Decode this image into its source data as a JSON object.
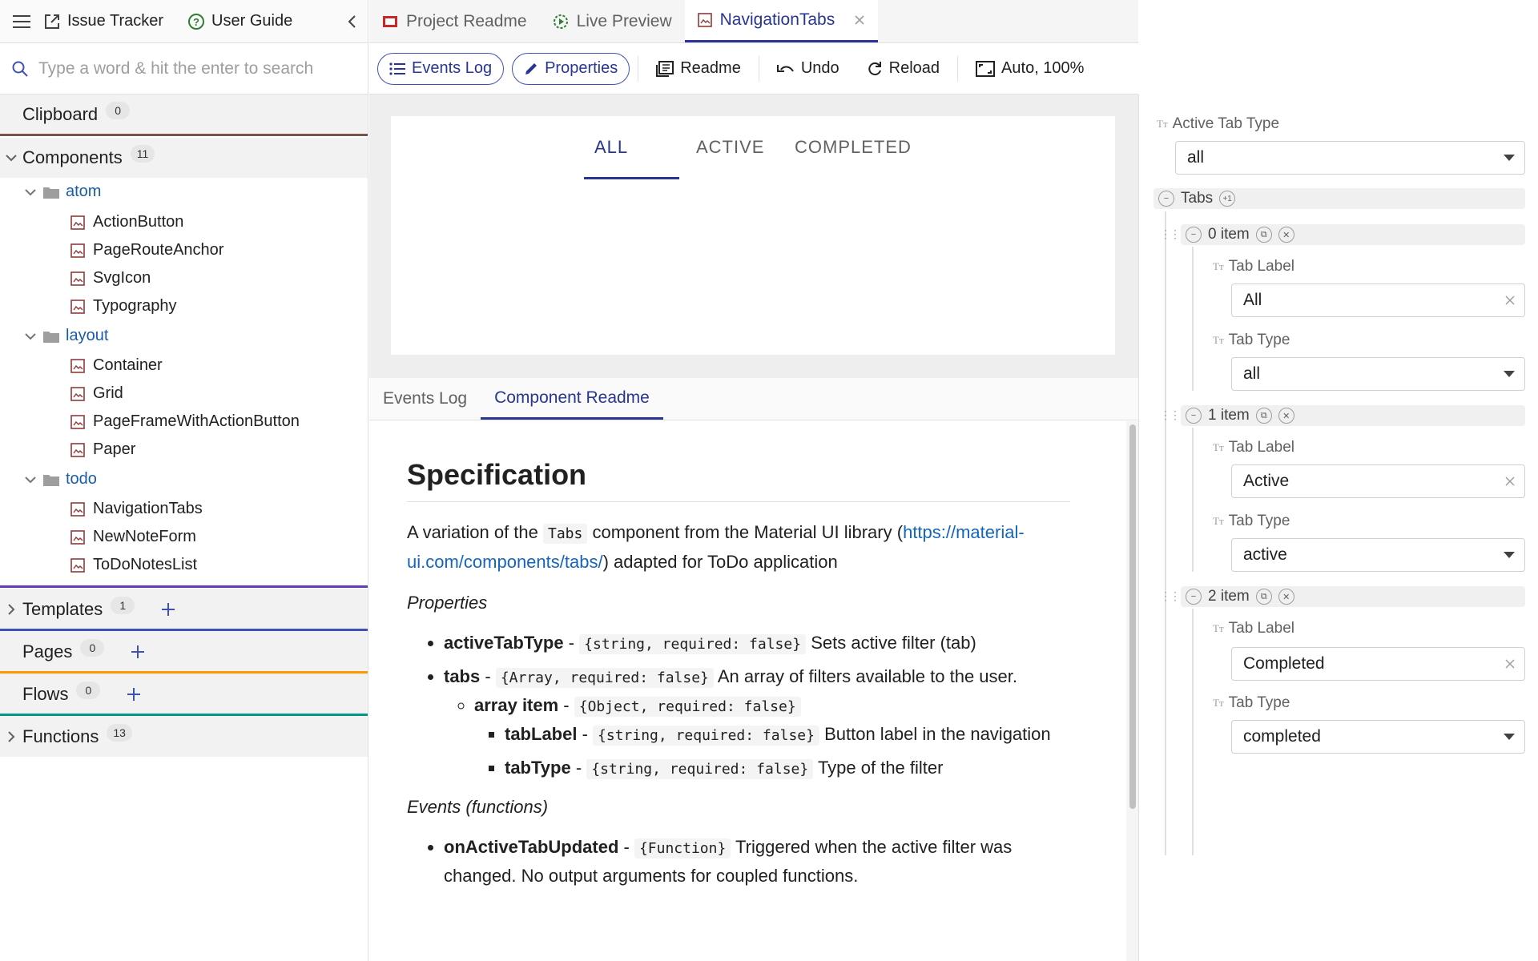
{
  "topbar": {
    "issue_tracker": "Issue Tracker",
    "user_guide": "User Guide"
  },
  "search": {
    "placeholder": "Type a word & hit the enter to search"
  },
  "sections": {
    "clipboard": {
      "label": "Clipboard",
      "count": "0"
    },
    "components": {
      "label": "Components",
      "count": "11"
    },
    "templates": {
      "label": "Templates",
      "count": "1"
    },
    "pages": {
      "label": "Pages",
      "count": "0"
    },
    "flows": {
      "label": "Flows",
      "count": "0"
    },
    "functions": {
      "label": "Functions",
      "count": "13"
    }
  },
  "tree": {
    "atom": {
      "label": "atom",
      "items": [
        "ActionButton",
        "PageRouteAnchor",
        "SvgIcon",
        "Typography"
      ]
    },
    "layout": {
      "label": "layout",
      "items": [
        "Container",
        "Grid",
        "PageFrameWithActionButton",
        "Paper"
      ]
    },
    "todo": {
      "label": "todo",
      "items": [
        "NavigationTabs",
        "NewNoteForm",
        "ToDoNotesList"
      ]
    }
  },
  "file_tabs": [
    "Project Readme",
    "Live Preview",
    "NavigationTabs"
  ],
  "toolbar": {
    "events_log": "Events Log",
    "properties": "Properties",
    "readme": "Readme",
    "undo": "Undo",
    "reload": "Reload",
    "zoom": "Auto, 100%"
  },
  "preview": {
    "tabs": [
      "ALL",
      "ACTIVE",
      "COMPLETED"
    ]
  },
  "sub_tabs": [
    "Events Log",
    "Component Readme"
  ],
  "readme": {
    "title": "Specification",
    "intro_1": "A variation of the ",
    "intro_code": "Tabs",
    "intro_2": " component from the Material UI library (",
    "intro_link": "https://material-ui.com/components/tabs/",
    "intro_3": ") adapted for ToDo application",
    "properties_heading": "Properties",
    "p1_name": "activeTabType",
    "p1_type": "{string, required: false}",
    "p1_desc": "Sets active filter (tab)",
    "p2_name": "tabs",
    "p2_type": "{Array, required: false}",
    "p2_desc": "An array of filters available to the user.",
    "p3_name": "array item",
    "p3_type": "{Object, required: false}",
    "p4_name": "tabLabel",
    "p4_type": "{string, required: false}",
    "p4_desc": "Button label in the navigation",
    "p5_name": "tabType",
    "p5_type": "{string, required: false}",
    "p5_desc": "Type of the filter",
    "events_heading": "Events (functions)",
    "e1_name": "onActiveTabUpdated",
    "e1_type": "{Function}",
    "e1_desc": "Triggered when the active filter was changed. No output arguments for coupled functions.",
    "sep": " - "
  },
  "props_panel": {
    "active_tab_type_label": "Active Tab Type",
    "active_tab_type_value": "all",
    "tabs_label": "Tabs",
    "tabs_add": "+1",
    "tab_label": "Tab Label",
    "tab_type": "Tab Type",
    "items": [
      {
        "header": "0 item",
        "label": "All",
        "type": "all"
      },
      {
        "header": "1 item",
        "label": "Active",
        "type": "active"
      },
      {
        "header": "2 item",
        "label": "Completed",
        "type": "completed"
      }
    ]
  },
  "colors": {
    "accent": "#283593",
    "link": "#1565c0",
    "clipboard_line": "#795548",
    "components_line": "#673ab7",
    "templates_line": "#3f51b5",
    "pages_line": "#ff9800",
    "flows_line": "#009688"
  }
}
